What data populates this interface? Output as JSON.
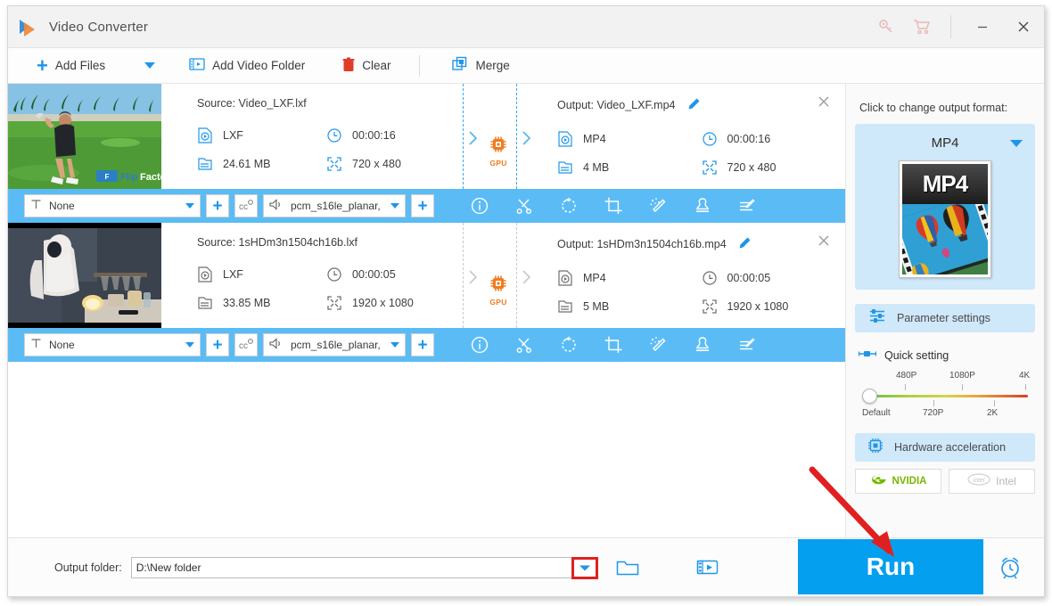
{
  "window": {
    "title": "Video Converter",
    "icons": {
      "key": "key-icon",
      "cart": "cart-icon",
      "minimize": "minimize-icon",
      "close": "close-icon"
    }
  },
  "toolbar": {
    "add_files": "Add Files",
    "add_video_folder": "Add Video Folder",
    "clear": "Clear",
    "merge": "Merge"
  },
  "files": [
    {
      "source_label": "Source: Video_LXF.lxf",
      "src_format": "LXF",
      "src_duration": "00:00:16",
      "src_size": "24.61 MB",
      "src_resolution": "720 x 480",
      "output_label": "Output: Video_LXF.mp4",
      "out_format": "MP4",
      "out_duration": "00:00:16",
      "out_size": "4 MB",
      "out_resolution": "720 x 480",
      "gpu_badge": "GPU",
      "selected": true,
      "subtitle_value": "None",
      "audio_value": "pcm_s16le_planar,",
      "thumb_watermark": "FlipFactory"
    },
    {
      "source_label": "Source: 1sHDm3n1504ch16b.lxf",
      "src_format": "LXF",
      "src_duration": "00:00:05",
      "src_size": "33.85 MB",
      "src_resolution": "1920 x 1080",
      "output_label": "Output: 1sHDm3n1504ch16b.mp4",
      "out_format": "MP4",
      "out_duration": "00:00:05",
      "out_size": "5 MB",
      "out_resolution": "1920 x 1080",
      "gpu_badge": "GPU",
      "selected": false,
      "subtitle_value": "None",
      "audio_value": "pcm_s16le_planar,",
      "thumb_watermark": ""
    }
  ],
  "strip_tools": [
    {
      "name": "info-icon",
      "title": "Information"
    },
    {
      "name": "cut-icon",
      "title": "Cut"
    },
    {
      "name": "rotate-icon",
      "title": "Rotate"
    },
    {
      "name": "crop-icon",
      "title": "Crop"
    },
    {
      "name": "effect-icon",
      "title": "Effect"
    },
    {
      "name": "watermark-icon",
      "title": "Watermark"
    },
    {
      "name": "subtitle-icon",
      "title": "Subtitle"
    }
  ],
  "right_panel": {
    "heading": "Click to change output format:",
    "format_name": "MP4",
    "format_badge": "MP4",
    "parameter_settings": "Parameter settings",
    "quick_setting": "Quick setting",
    "slider": {
      "top_labels": [
        "480P",
        "1080P",
        "4K"
      ],
      "bottom_labels": [
        "Default",
        "720P",
        "2K"
      ],
      "value": "Default"
    },
    "hardware_acceleration": "Hardware acceleration",
    "vendors": [
      {
        "label": "NVIDIA",
        "active": true
      },
      {
        "label": "Intel",
        "active": false
      }
    ]
  },
  "footer": {
    "output_folder_label": "Output folder:",
    "output_folder_value": "D:\\New folder",
    "run_label": "Run",
    "icons": {
      "dropdown": "chevron-down-icon",
      "browse": "folder-icon",
      "open_output": "open-video-folder-icon",
      "alarm": "alarm-icon"
    }
  },
  "colors": {
    "accent": "#1f96e8",
    "run": "#059ff0",
    "strip_selected": "#5bbcf5",
    "panel_box": "#cfe8fa",
    "gpu": "#f07c1f",
    "annotation": "#e02020"
  }
}
